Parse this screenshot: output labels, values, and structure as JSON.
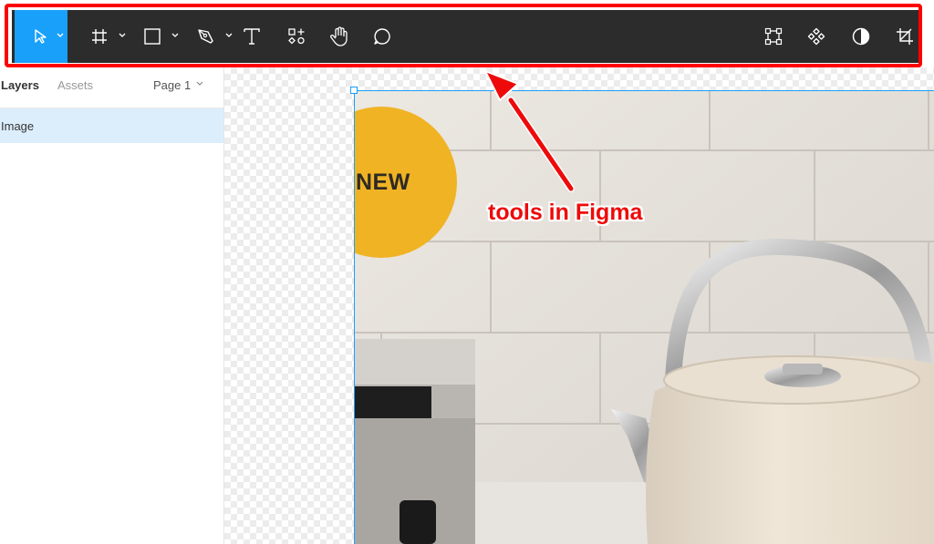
{
  "left_panel": {
    "tabs": {
      "layers": "Layers",
      "assets": "Assets"
    },
    "page_select": "Page 1",
    "layers": [
      {
        "label": "Image"
      }
    ]
  },
  "canvas": {
    "badge_text": "NEW",
    "annotation": "tools in Figma"
  },
  "toolbar": {
    "left_tools": [
      "move-tool",
      "frame-tool",
      "shape-tool",
      "pen-tool",
      "text-tool",
      "resources-tool",
      "hand-tool",
      "comment-tool"
    ],
    "right_tools": [
      "transform-tool",
      "component-tool",
      "mask-tool",
      "crop-tool"
    ],
    "active_tool": "move-tool"
  },
  "colors": {
    "toolbar_bg": "#2c2c2c",
    "active_tool": "#18a0fb",
    "selection": "#18a0fb",
    "highlight": "#ff0000",
    "badge": "#f0b324"
  }
}
